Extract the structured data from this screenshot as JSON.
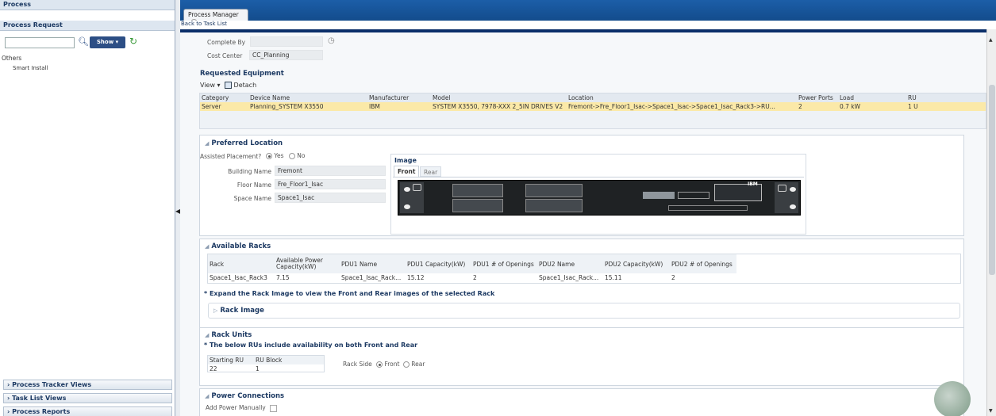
{
  "sidebar": {
    "process_header": "Process",
    "request_header": "Process Request",
    "show_label": "Show",
    "others_label": "Others",
    "items": [
      {
        "label": "Smart Install"
      }
    ],
    "bottom": [
      {
        "label": "Process Tracker Views"
      },
      {
        "label": "Task List Views"
      },
      {
        "label": "Process Reports"
      }
    ]
  },
  "tab": {
    "label": "Process Manager"
  },
  "back_link": "Back to Task List",
  "form": {
    "complete_by_label": "Complete By",
    "complete_by_value": "",
    "cost_center_label": "Cost Center",
    "cost_center_value": "CC_Planning"
  },
  "requested_equipment": {
    "title": "Requested Equipment",
    "view_label": "View",
    "detach_label": "Detach",
    "columns": [
      "Category",
      "Device Name",
      "Manufacturer",
      "Model",
      "Location",
      "Power Ports",
      "Load",
      "RU"
    ],
    "rows": [
      [
        "Server",
        "Planning_SYSTEM X3550",
        "IBM",
        "SYSTEM X3550, 7978-XXX 2_5IN DRIVES V2",
        "Fremont->Fre_Floor1_Isac->Space1_Isac->Space1_Isac_Rack3->RU...",
        "2",
        "0.7 kW",
        "1 U"
      ]
    ]
  },
  "preferred_location": {
    "title": "Preferred Location",
    "assisted_label": "Assisted Placement?",
    "yes_label": "Yes",
    "no_label": "No",
    "building_label": "Building Name",
    "building_value": "Fremont",
    "floor_label": "Floor Name",
    "floor_value": "Fre_Floor1_Isac",
    "space_label": "Space Name",
    "space_value": "Space1_Isac",
    "image_title": "Image",
    "image_tabs": [
      "Front",
      "Rear"
    ],
    "server_brand": "IBM"
  },
  "available_racks": {
    "title": "Available Racks",
    "columns": [
      "Rack",
      "Available Power Capacity(kW)",
      "PDU1 Name",
      "PDU1 Capacity(kW)",
      "PDU1 # of Openings",
      "PDU2 Name",
      "PDU2 Capacity(kW)",
      "PDU2 # of Openings"
    ],
    "rows": [
      [
        "Space1_Isac_Rack3",
        "7.15",
        "Space1_Isac_Rack...",
        "15.12",
        "2",
        "Space1_Isac_Rack...",
        "15.11",
        "2"
      ]
    ],
    "note": "* Expand the Rack Image to view the Front and Rear images of the selected Rack",
    "rack_image_label": "Rack Image"
  },
  "rack_units": {
    "title": "Rack Units",
    "note": "* The below RUs include availability on both Front and Rear",
    "columns": [
      "Starting RU",
      "RU Block"
    ],
    "rows": [
      [
        "22",
        "1"
      ]
    ],
    "side_label": "Rack Side",
    "front_label": "Front",
    "rear_label": "Rear"
  },
  "power_connections": {
    "title": "Power Connections",
    "manual_label": "Add Power Manually"
  },
  "colors": {
    "accent": "#1d3a63",
    "tabbar": "#1c5ea8",
    "selected_row": "#fbe9a8",
    "dark_band": "#0b2f69"
  }
}
